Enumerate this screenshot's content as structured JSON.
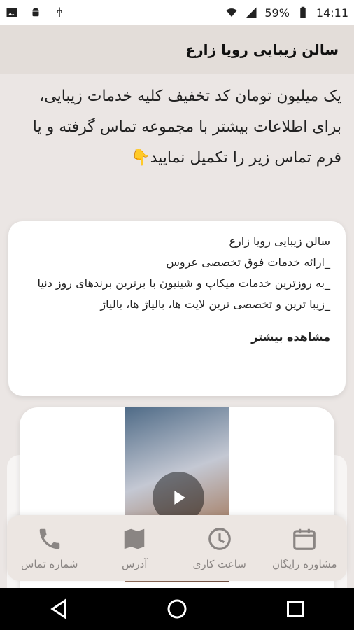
{
  "status": {
    "battery": "59%",
    "time": "14:11"
  },
  "app": {
    "title": "سالن زیبایی رویا زارع"
  },
  "promo": {
    "text": "یک میلیون تومان کد تخفیف کلیه خدمات زیبایی، برای اطلاعات بیشتر با مجموعه تماس گرفته و یا فرم تماس زیر را تکمیل نمایید👇"
  },
  "card": {
    "lines": [
      "سالن زیبایی رویا زارع",
      "_ارائه خدمات فوق تخصصی عروس",
      "_به روزترین خدمات میکاپ و شینیون با برترین برندهای روز دنیا",
      "_زیبا ترین و تخصصی ترین لایت ها، بالیاژ ها، بالیاژ"
    ],
    "more": "مشاهده بیشتر"
  },
  "bottom_nav": [
    {
      "label": "شماره تماس",
      "icon": "phone-icon"
    },
    {
      "label": "آدرس",
      "icon": "map-icon"
    },
    {
      "label": "ساعت کاری",
      "icon": "clock-icon"
    },
    {
      "label": "مشاوره رایگان",
      "icon": "calendar-icon"
    }
  ]
}
